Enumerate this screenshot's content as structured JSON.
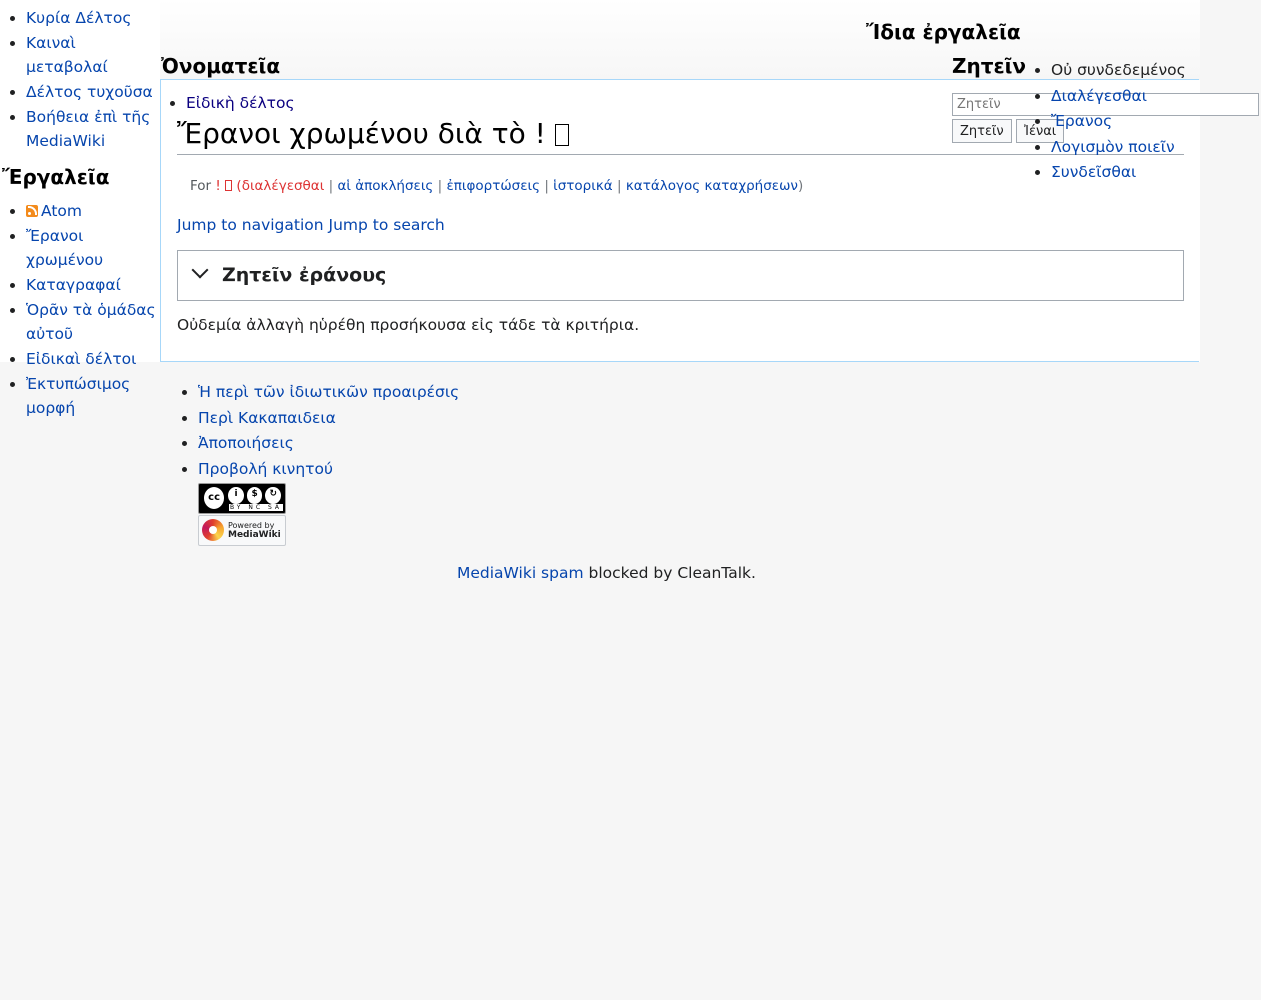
{
  "sidebar": {
    "nav_items": [
      {
        "label": "Κυρία Δέλτος"
      },
      {
        "label": "Καιναὶ μεταβολαί"
      },
      {
        "label": "Δέλτος τυχοῦσα"
      },
      {
        "label": "Βοήθεια ἐπὶ τῆς MediaWiki"
      }
    ],
    "tools_heading": "Ἔργαλεῖα",
    "tools_items": [
      {
        "label": "Atom",
        "icon": "rss-icon"
      },
      {
        "label": "Ἔρανοι χρωμένου"
      },
      {
        "label": "Καταγραφαί"
      },
      {
        "label": "Ὁρᾶν τὰ ὁμάδας αὐτοῦ"
      },
      {
        "label": "Εἰδικαὶ δέλτοι"
      },
      {
        "label": "Ἐκτυπώσιμος μορφή"
      }
    ]
  },
  "header": {
    "personal_heading": "Ἴδια ἐργαλεῖα",
    "namespaces_heading": "Ὀνοματεῖα",
    "search_heading": "Ζητεῖν",
    "personal_items": [
      {
        "label": "Οὐ συνδεδεμένος",
        "link": false
      },
      {
        "label": "Διαλέγεσθαι",
        "link": true
      },
      {
        "label": "Ἔρανος",
        "link": true
      },
      {
        "label": "Λογισμὸν ποιεῖν",
        "link": true
      },
      {
        "label": "Συνδεῖσθαι",
        "link": true
      }
    ],
    "search": {
      "placeholder": "Ζητεῖν",
      "search_button": "Ζητεῖν",
      "go_button": "Ἰέναι"
    }
  },
  "content": {
    "namespace_tab": "Εἰδικὴ δέλτος",
    "title": "Ἔρανοι χρωμένου διὰ τὸ !",
    "sub": {
      "prefix": "For",
      "user": "!",
      "talk": "διαλέγεσθαι",
      "links": [
        "αἱ ἀποκλήσεις",
        "ἐπιφορτώσεις",
        "ἱστορικά",
        "κατάλογος καταχρήσεων"
      ]
    },
    "jump_nav": "Jump to navigation",
    "jump_search": "Jump to search",
    "fieldset_label": "Ζητεῖν ἐράνους",
    "no_results": "Οὐδεμία ἀλλαγὴ ηὑρέθη προσήκουσα εἰς τάδε τὰ κριτήρια."
  },
  "footer": {
    "links": [
      {
        "label": "Ἡ περὶ τῶν ἰδιωτικῶν προαιρέσις"
      },
      {
        "label": "Περὶ Κακαπαιδεια"
      },
      {
        "label": "Ἀποποιήσεις"
      },
      {
        "label": "Προβολή κινητού"
      }
    ],
    "cc_badge": {
      "text": "BY NC SA",
      "cc": "cc",
      "icon": "cc-by-nc-sa-icon"
    },
    "mw_badge": {
      "line1": "Powered by",
      "line2": "MediaWiki",
      "icon": "mediawiki-flower-icon"
    },
    "cleantalk_link": "MediaWiki spam",
    "cleantalk_text": " blocked by CleanTalk."
  },
  "colors": {
    "link": "#0645ad",
    "new_link": "#d33",
    "border": "#a7d7f9"
  }
}
